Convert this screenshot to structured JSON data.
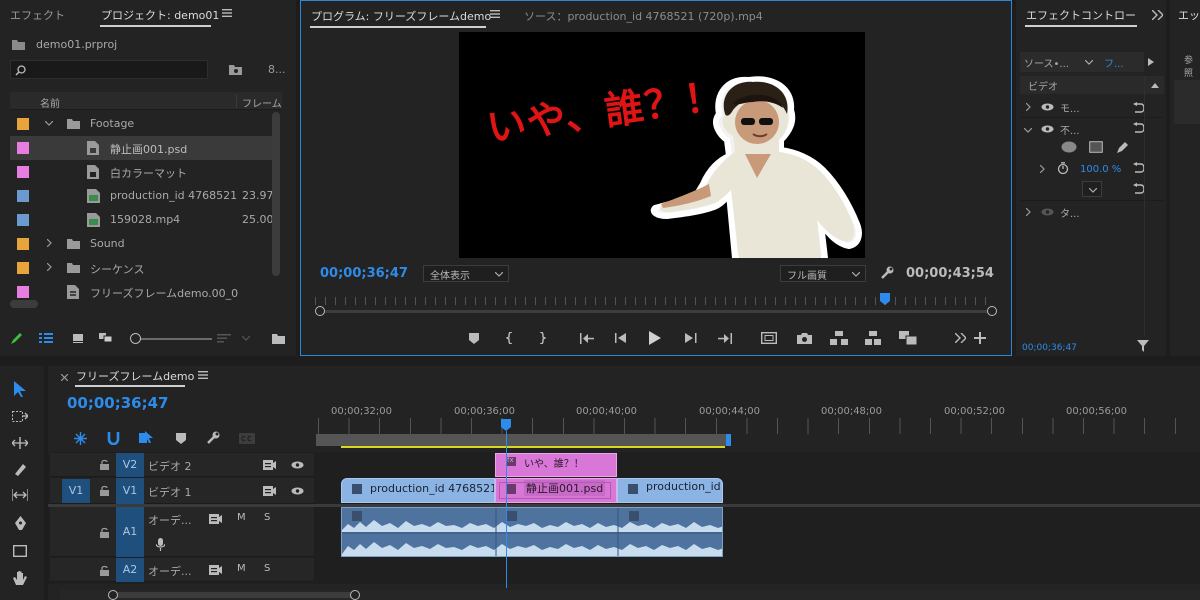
{
  "project_panel": {
    "tabs": [
      "エフェクト",
      "プロジェクト: demo01"
    ],
    "file_name": "demo01.prproj",
    "search_placeholder": "",
    "item_count": "8...",
    "columns": [
      "名前",
      "フレーム"
    ],
    "items": [
      {
        "name": "Footage",
        "rate": "",
        "color": "#e8a33a",
        "kind": "folder"
      },
      {
        "name": "静止画001.psd",
        "rate": "",
        "color": "#e57ee0",
        "kind": "still"
      },
      {
        "name": "白カラーマット",
        "rate": "",
        "color": "#e57ee0",
        "kind": "still"
      },
      {
        "name": "production_id 4768521",
        "rate": "23.97",
        "color": "#6c9ad0",
        "kind": "video"
      },
      {
        "name": "159028.mp4",
        "rate": "25.00",
        "color": "#6c9ad0",
        "kind": "video"
      },
      {
        "name": "Sound",
        "rate": "",
        "color": "#e8a33a",
        "kind": "folder"
      },
      {
        "name": "シーケンス",
        "rate": "",
        "color": "#e8a33a",
        "kind": "folder"
      },
      {
        "name": "フリーズフレームdemo.00_0",
        "rate": "",
        "color": "#e57ee0",
        "kind": "seq"
      }
    ]
  },
  "program_monitor": {
    "tab": "プログラム: フリーズフレームdemo",
    "source_tab": "ソース：production_id 4768521 (720p).mp4",
    "overlay_text": "いや、誰？！",
    "timecode_current": "00;00;36;47",
    "timecode_duration": "00;00;43;54",
    "zoom": "全体表示",
    "quality": "フル画質",
    "playhead_fraction": 0.84
  },
  "effect_controls": {
    "tab": "エフェクトコントロー",
    "tab2": "エッ",
    "source_label": "ソース•...",
    "target_label": "フ...",
    "ref_label": "参照",
    "section": "ビデオ",
    "motion": "モ...",
    "opacity": "不...",
    "opacity_value": "100.0 %",
    "time_remap": "タ...",
    "footer_timecode": "00;00;36;47"
  },
  "timeline": {
    "tab": "フリーズフレームdemo",
    "timecode": "00;00;36;47",
    "ruler_labels": [
      "00;00;32;00",
      "00;00;36;00",
      "00;00;40;00",
      "00;00;44;00",
      "00;00;48;00",
      "00;00;52;00",
      "00;00;56;00"
    ],
    "tracks": [
      {
        "src": "",
        "name": "V2",
        "label": "ビデオ 2"
      },
      {
        "src": "V1",
        "name": "V1",
        "label": "ビデオ 1"
      },
      {
        "src": "",
        "name": "A1",
        "label": "オーデ..."
      },
      {
        "src": "",
        "name": "A2",
        "label": "オーデ..."
      }
    ],
    "clips": {
      "v2_title": "いや、誰？！",
      "v1_a": "production_id 4768521 (",
      "v1_b": "静止画001.psd",
      "v1_c": "production_id"
    },
    "mute_label": "M",
    "solo_label": "S",
    "fx_label": "fx"
  }
}
